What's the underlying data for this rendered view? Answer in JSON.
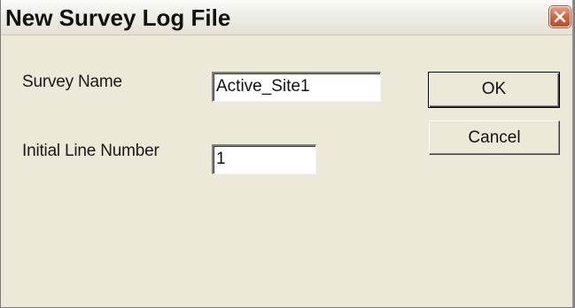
{
  "window": {
    "title": "New Survey Log File"
  },
  "form": {
    "survey_name_label": "Survey Name",
    "survey_name_value": "Active_Site1",
    "initial_line_label": "Initial Line Number",
    "initial_line_value": "1"
  },
  "buttons": {
    "ok_label": "OK",
    "cancel_label": "Cancel"
  },
  "icons": {
    "close": "close-icon"
  },
  "colors": {
    "dialog_bg": "#ece9d8",
    "close_button": "#d9663f"
  }
}
